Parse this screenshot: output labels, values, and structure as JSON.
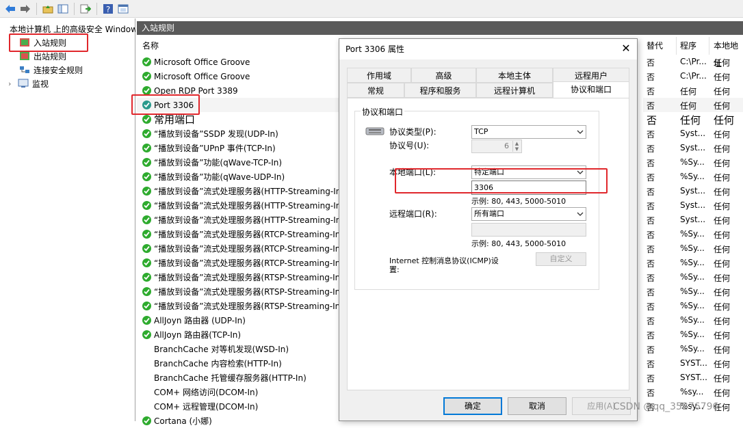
{
  "toolbar": {
    "icons": [
      "back-arrow-icon",
      "forward-arrow-icon",
      "up-folder-icon",
      "show-hide-icon",
      "export-icon",
      "help-icon",
      "properties-icon"
    ]
  },
  "tree": {
    "root": "本地计算机 上的高级安全 Windows",
    "items": [
      "入站规则",
      "出站规则",
      "连接安全规则",
      "监视"
    ]
  },
  "middle": {
    "header": "入站规则",
    "column_name": "名称",
    "rules": [
      {
        "name": "Microsoft Office Groove",
        "enabled": true
      },
      {
        "name": "Microsoft Office Groove",
        "enabled": true
      },
      {
        "name": "Open RDP Port 3389",
        "enabled": true
      },
      {
        "name": "Port 3306",
        "enabled": true
      },
      {
        "name": "常用端口",
        "enabled": true
      },
      {
        "name": "“播放到设备”SSDP 发现(UDP-In)",
        "enabled": true
      },
      {
        "name": "“播放到设备”UPnP 事件(TCP-In)",
        "enabled": true
      },
      {
        "name": "“播放到设备”功能(qWave-TCP-In)",
        "enabled": true
      },
      {
        "name": "“播放到设备”功能(qWave-UDP-In)",
        "enabled": true
      },
      {
        "name": "“播放到设备”流式处理服务器(HTTP-Streaming-In)",
        "enabled": true
      },
      {
        "name": "“播放到设备”流式处理服务器(HTTP-Streaming-In)",
        "enabled": true
      },
      {
        "name": "“播放到设备”流式处理服务器(HTTP-Streaming-In)",
        "enabled": true
      },
      {
        "name": "“播放到设备”流式处理服务器(RTCP-Streaming-In)",
        "enabled": true
      },
      {
        "name": "“播放到设备”流式处理服务器(RTCP-Streaming-In)",
        "enabled": true
      },
      {
        "name": "“播放到设备”流式处理服务器(RTCP-Streaming-In)",
        "enabled": true
      },
      {
        "name": "“播放到设备”流式处理服务器(RTSP-Streaming-In)",
        "enabled": true
      },
      {
        "name": "“播放到设备”流式处理服务器(RTSP-Streaming-In)",
        "enabled": true
      },
      {
        "name": "“播放到设备”流式处理服务器(RTSP-Streaming-In)",
        "enabled": true
      },
      {
        "name": "AllJoyn 路由器 (UDP-In)",
        "enabled": true
      },
      {
        "name": "AllJoyn 路由器(TCP-In)",
        "enabled": true
      },
      {
        "name": "BranchCache 对等机发现(WSD-In)",
        "enabled": false
      },
      {
        "name": "BranchCache 内容检索(HTTP-In)",
        "enabled": false
      },
      {
        "name": "BranchCache 托管缓存服务器(HTTP-In)",
        "enabled": false
      },
      {
        "name": "COM+ 网络访问(DCOM-In)",
        "enabled": false
      },
      {
        "name": "COM+ 远程管理(DCOM-In)",
        "enabled": false
      },
      {
        "name": "Cortana (小娜)",
        "enabled": true
      }
    ]
  },
  "right": {
    "columns": [
      "替代",
      "程序",
      "本地地址"
    ],
    "rows": [
      [
        "否",
        "C:\\Pr...",
        "任何"
      ],
      [
        "否",
        "C:\\Pr...",
        "任何"
      ],
      [
        "否",
        "任何",
        "任何"
      ],
      [
        "否",
        "任何",
        "任何"
      ],
      [
        "否",
        "任何",
        "任何"
      ],
      [
        "否",
        "Syst...",
        "任何"
      ],
      [
        "否",
        "Syst...",
        "任何"
      ],
      [
        "否",
        "%Sy...",
        "任何"
      ],
      [
        "否",
        "%Sy...",
        "任何"
      ],
      [
        "否",
        "Syst...",
        "任何"
      ],
      [
        "否",
        "Syst...",
        "任何"
      ],
      [
        "否",
        "Syst...",
        "任何"
      ],
      [
        "否",
        "%Sy...",
        "任何"
      ],
      [
        "否",
        "%Sy...",
        "任何"
      ],
      [
        "否",
        "%Sy...",
        "任何"
      ],
      [
        "否",
        "%Sy...",
        "任何"
      ],
      [
        "否",
        "%Sy...",
        "任何"
      ],
      [
        "否",
        "%Sy...",
        "任何"
      ],
      [
        "否",
        "%Sy...",
        "任何"
      ],
      [
        "否",
        "%Sy...",
        "任何"
      ],
      [
        "否",
        "%Sy...",
        "任何"
      ],
      [
        "否",
        "SYST...",
        "任何"
      ],
      [
        "否",
        "SYST...",
        "任何"
      ],
      [
        "否",
        "%sy...",
        "任何"
      ],
      [
        "否",
        "%sy...",
        "任何"
      ]
    ]
  },
  "dialog": {
    "title": "Port 3306 属性",
    "tabs_top": [
      "作用域",
      "高级",
      "本地主体",
      "远程用户"
    ],
    "tabs_bottom": [
      "常规",
      "程序和服务",
      "远程计算机",
      "协议和端口"
    ],
    "group_title": "协议和端口",
    "protocol_type_label": "协议类型(P):",
    "protocol_type_value": "TCP",
    "protocol_number_label": "协议号(U):",
    "protocol_number_value": "6",
    "local_port_label": "本地端口(L):",
    "local_port_select": "特定端口",
    "local_port_value": "3306",
    "local_port_example": "示例: 80, 443, 5000-5010",
    "remote_port_label": "远程端口(R):",
    "remote_port_select": "所有端口",
    "remote_port_value": "",
    "remote_port_example": "示例: 80, 443, 5000-5010",
    "icmp_label_line1": "Internet 控制消息协议(ICMP)设",
    "icmp_label_line2": "置:",
    "customize_button": "自定义",
    "ok_button": "确定",
    "cancel_button": "取消",
    "apply_button": "应用(A)"
  },
  "watermark": "CSDN @qq_35276796",
  "colors": {
    "highlight": "#e0262b",
    "enabled": "#2eab2e",
    "header": "#5a5a5a"
  }
}
